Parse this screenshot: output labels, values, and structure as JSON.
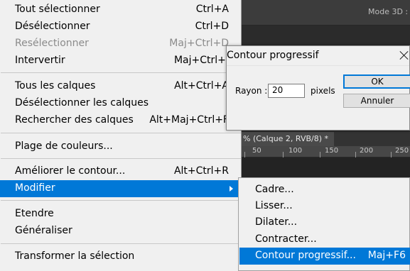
{
  "main_menu": {
    "items": [
      {
        "label": "Tout sélectionner",
        "shortcut": "Ctrl+A"
      },
      {
        "label": "Désélectionner",
        "shortcut": "Ctrl+D"
      },
      {
        "label": "Resélectionner",
        "shortcut": "Maj+Ctrl+D",
        "disabled": true
      },
      {
        "label": "Intervertir",
        "shortcut": "Maj+Ctrl+I"
      },
      {
        "label": "Tous les calques",
        "shortcut": "Alt+Ctrl+A"
      },
      {
        "label": "Désélectionner les calques",
        "shortcut": ""
      },
      {
        "label": "Rechercher des calques",
        "shortcut": "Alt+Maj+Ctrl+F"
      },
      {
        "label": "Plage de couleurs...",
        "shortcut": ""
      },
      {
        "label": "Améliorer le contour...",
        "shortcut": "Alt+Ctrl+R"
      },
      {
        "label": "Modifier",
        "shortcut": "",
        "highlighted": true
      },
      {
        "label": "Etendre",
        "shortcut": ""
      },
      {
        "label": "Généraliser",
        "shortcut": ""
      },
      {
        "label": "Transformer la sélection",
        "shortcut": ""
      }
    ]
  },
  "submenu": {
    "items": [
      {
        "label": "Cadre...",
        "shortcut": ""
      },
      {
        "label": "Lisser...",
        "shortcut": ""
      },
      {
        "label": "Dilater...",
        "shortcut": ""
      },
      {
        "label": "Contracter...",
        "shortcut": ""
      },
      {
        "label": "Contour progressif...",
        "shortcut": "Maj+F6",
        "highlighted": true
      }
    ]
  },
  "dialog": {
    "title": "Contour progressif",
    "radius_label": "Rayon :",
    "radius_value": "20",
    "radius_unit": "pixels",
    "ok_label": "OK",
    "cancel_label": "Annuler"
  },
  "photoshop": {
    "mode3d_label": "Mode 3D :",
    "doc_tab": "% (Calque 2, RVB/8) *",
    "ruler_numbers": [
      "50",
      "100",
      "150",
      "200",
      "250"
    ]
  },
  "colors": {
    "highlight": "#0078d7",
    "menu_bg": "#f0f0f0",
    "disabled_text": "#8b8b8b"
  }
}
